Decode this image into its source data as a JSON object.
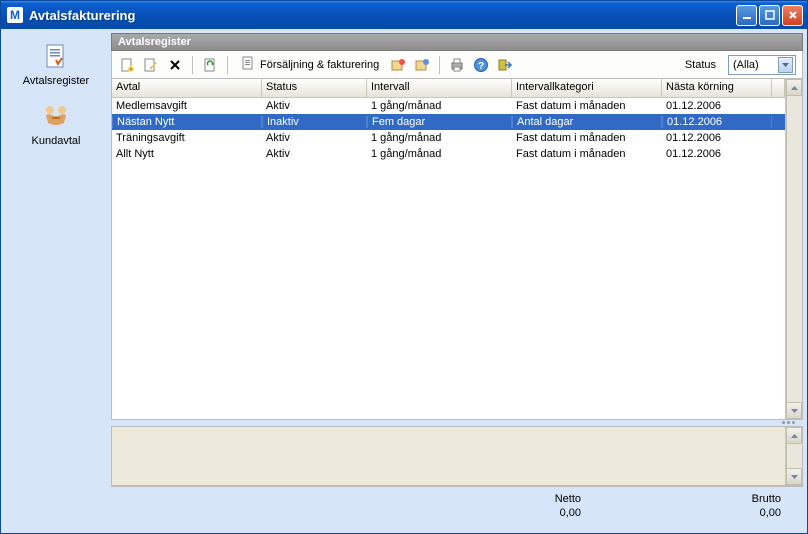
{
  "window": {
    "app_icon": "M",
    "title": "Avtalsfakturering"
  },
  "sidebar": {
    "items": [
      {
        "id": "avtalsregister",
        "label": "Avtalsregister",
        "icon": "doc"
      },
      {
        "id": "kundavtal",
        "label": "Kundavtal",
        "icon": "handshake"
      }
    ]
  },
  "panel": {
    "title": "Avtalsregister"
  },
  "toolbar": {
    "new_icon": "new",
    "edit_icon": "edit",
    "delete_icon": "delete",
    "refresh_icon": "refresh",
    "sales_btn": {
      "icon": "print",
      "label": "Försäljning & fakturering"
    },
    "extra1": "box1",
    "extra2": "box2",
    "print_icon": "printer",
    "help_icon": "help",
    "exit_icon": "exit",
    "status_label": "Status",
    "status_value": "(Alla)"
  },
  "table": {
    "columns": [
      "Avtal",
      "Status",
      "Intervall",
      "Intervallkategori",
      "Nästa körning"
    ],
    "rows": [
      {
        "c": [
          "Medlemsavgift",
          "Aktiv",
          "1 gång/månad",
          "Fast datum i månaden",
          "01.12.2006"
        ],
        "selected": false
      },
      {
        "c": [
          "Nästan Nytt",
          "Inaktiv",
          "Fem dagar",
          "Antal dagar",
          "01.12.2006"
        ],
        "selected": true
      },
      {
        "c": [
          "Träningsavgift",
          "Aktiv",
          "1 gång/månad",
          "Fast datum i månaden",
          "01.12.2006"
        ],
        "selected": false
      },
      {
        "c": [
          "Allt Nytt",
          "Aktiv",
          "1 gång/månad",
          "Fast datum i månaden",
          "01.12.2006"
        ],
        "selected": false
      }
    ]
  },
  "totals": {
    "netto_label": "Netto",
    "netto_value": "0,00",
    "brutto_label": "Brutto",
    "brutto_value": "0,00"
  }
}
